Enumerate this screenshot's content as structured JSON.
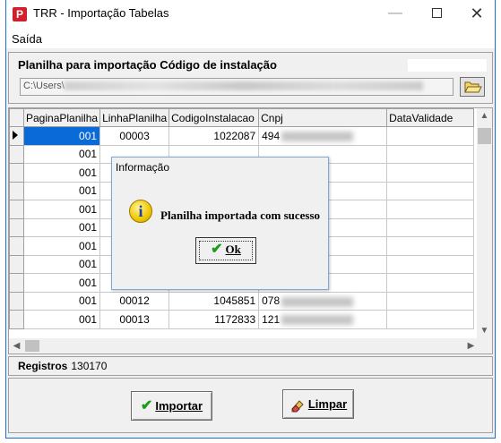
{
  "window": {
    "title": "TRR - Importação Tabelas",
    "app_icon": "P"
  },
  "menu": {
    "items": [
      "Saída"
    ]
  },
  "file": {
    "label": "Planilha para importação Código de instalação",
    "path": "C:\\Users\\"
  },
  "grid": {
    "columns": [
      "PaginaPlanilha",
      "LinhaPlanilha",
      "CodigoInstalacao",
      "Cnpj",
      "DataValidade"
    ],
    "rows": [
      {
        "pagina": "001",
        "linha": "00003",
        "codigo": "1022087",
        "cnpj": "494"
      },
      {
        "pagina": "001",
        "linha": "",
        "codigo": "",
        "cnpj": ""
      },
      {
        "pagina": "001",
        "linha": "",
        "codigo": "",
        "cnpj": ""
      },
      {
        "pagina": "001",
        "linha": "",
        "codigo": "",
        "cnpj": ""
      },
      {
        "pagina": "001",
        "linha": "",
        "codigo": "",
        "cnpj": ""
      },
      {
        "pagina": "001",
        "linha": "",
        "codigo": "",
        "cnpj": ""
      },
      {
        "pagina": "001",
        "linha": "",
        "codigo": "",
        "cnpj": ""
      },
      {
        "pagina": "001",
        "linha": "",
        "codigo": "",
        "cnpj": ""
      },
      {
        "pagina": "001",
        "linha": "",
        "codigo": "",
        "cnpj": ""
      },
      {
        "pagina": "001",
        "linha": "00012",
        "codigo": "1045851",
        "cnpj": "078"
      },
      {
        "pagina": "001",
        "linha": "00013",
        "codigo": "1172833",
        "cnpj": "121"
      }
    ]
  },
  "status": {
    "label": "Registros",
    "count": "130170"
  },
  "buttons": {
    "importar": "Importar",
    "limpar": "Limpar"
  },
  "dialog": {
    "title": "Informação",
    "message": "Planilha importada com sucesso",
    "ok": "Ok"
  },
  "icons": {
    "app": "trr-app-icon",
    "folder": "folder-open-icon",
    "info": "info-icon",
    "check": "check-icon",
    "eraser": "eraser-icon"
  },
  "colors": {
    "selection": "#0a6ad8",
    "app_icon": "#d21f2b",
    "window_border": "#1e6fd0"
  }
}
